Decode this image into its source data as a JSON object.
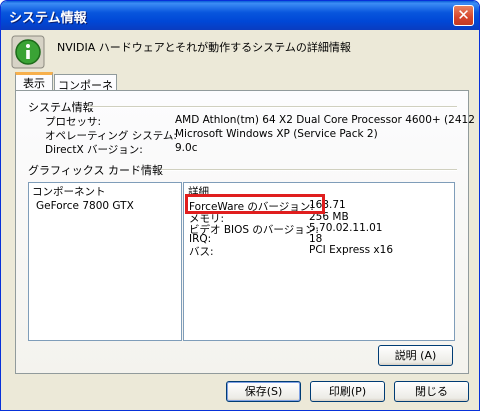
{
  "window": {
    "title": "システム情報",
    "close_symbol": "✕"
  },
  "header": {
    "text": "NVIDIA ハードウェアとそれが動作するシステムの詳細情報",
    "icon": "info-icon"
  },
  "tabs": [
    {
      "label": "表示"
    },
    {
      "label": "コンポーネント"
    }
  ],
  "system_info": {
    "section_title": "システム情報",
    "rows": [
      {
        "label": "プロセッサ:",
        "value": "AMD Athlon(tm) 64 X2 Dual Core Processor 4600+ (2412"
      },
      {
        "label": "オペレーティング システム:",
        "value": "Microsoft Windows XP (Service Pack 2)"
      },
      {
        "label": "DirectX バージョン:",
        "value": "9.0c"
      }
    ]
  },
  "graphics_info": {
    "section_title": "グラフィックス カード情報",
    "component_header": "コンポーネント",
    "detail_header": "詳細",
    "component": "GeForce 7800 GTX",
    "details": [
      {
        "label": "ForceWare のバージョン:",
        "value": "163.71"
      },
      {
        "label": "メモリ:",
        "value": "256 MB"
      },
      {
        "label": "ビデオ BIOS のバージョン:",
        "value": "5.70.02.11.01"
      },
      {
        "label": "IRQ:",
        "value": "18"
      },
      {
        "label": "バス:",
        "value": "PCI Express x16"
      }
    ]
  },
  "buttons": {
    "help": "説明 (A)",
    "save": "保存(S)",
    "print": "印刷(P)",
    "close": "閉じる"
  },
  "colors": {
    "title_bar": "#0054e3",
    "highlight_border": "#e01e1e",
    "tab_accent": "#f7b04c"
  }
}
